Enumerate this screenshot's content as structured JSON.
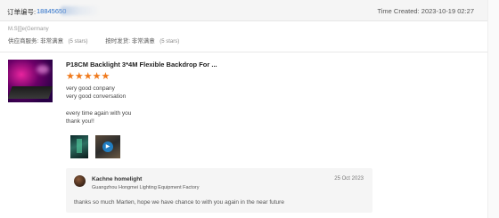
{
  "order": {
    "label": "订单编号:",
    "number": "18845650",
    "time_created": "Time Created: 2023-10-19 02:27"
  },
  "buyer": {
    "name": "M.S[[]e(Germany",
    "supplier_service_label": "供应商服务: 非常满意",
    "supplier_service_stars": "(5 stars)",
    "delivery_label": "按时发货: 非常满意",
    "delivery_stars": "(5 stars)"
  },
  "product": {
    "title": "P18CM Backlight 3*4M Flexible Backdrop For ...",
    "rating": 5,
    "stars_text": "★★★★★"
  },
  "review": {
    "lines_1": [
      "very good conpany",
      "very good conversation"
    ],
    "lines_2": [
      "every time again with you",
      "thank you!!"
    ]
  },
  "reply": {
    "seller_name": "Kachne homelight",
    "company": "Guangzhou Hongmei Lighting Equipment Factory",
    "date": "25 Oct 2023",
    "text": "thanks so much Marten, hope we have chance to with you again in the near future"
  },
  "colors": {
    "accent_link": "#2a6fc9",
    "star": "#f07a1c"
  },
  "icons": {
    "play": "play-icon",
    "flag": "flag-icon"
  }
}
